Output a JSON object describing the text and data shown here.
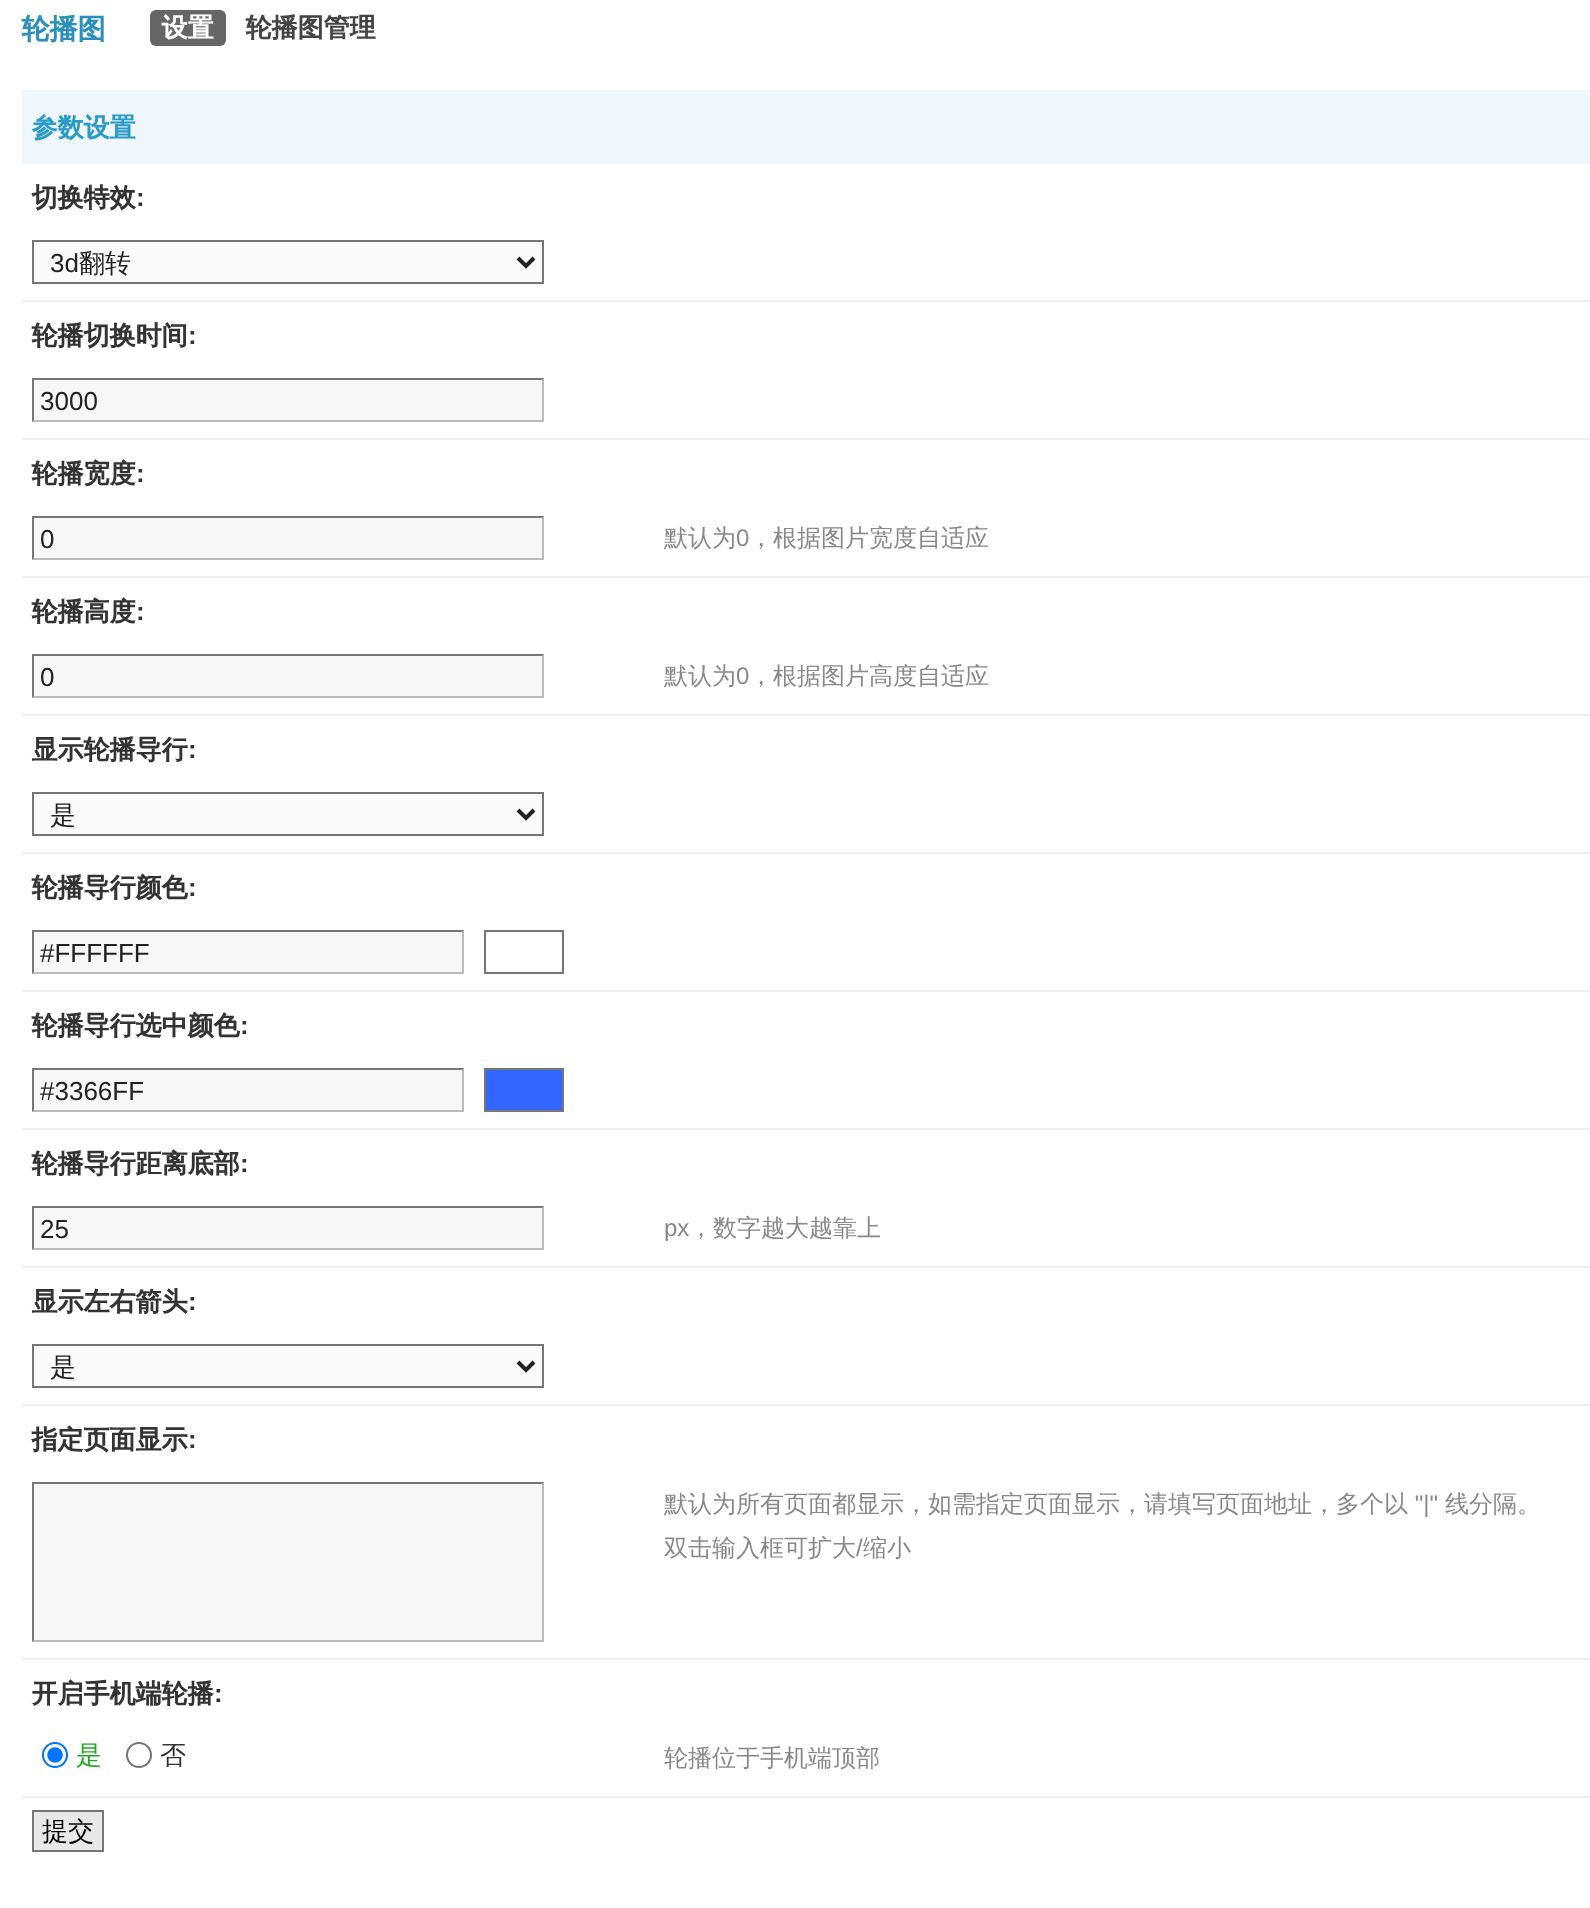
{
  "header": {
    "title": "轮播图",
    "tabs": [
      {
        "label": "设置",
        "selected": true
      },
      {
        "label": "轮播图管理",
        "selected": false
      }
    ]
  },
  "panel": {
    "title": "参数设置",
    "fields": [
      {
        "kind": "select",
        "label": "切换特效:",
        "value": "3d翻转"
      },
      {
        "kind": "text",
        "label": "轮播切换时间:",
        "value": "3000"
      },
      {
        "kind": "text",
        "label": "轮播宽度:",
        "value": "0",
        "hint": "默认为0，根据图片宽度自适应"
      },
      {
        "kind": "text",
        "label": "轮播高度:",
        "value": "0",
        "hint": "默认为0，根据图片高度自适应"
      },
      {
        "kind": "select",
        "label": "显示轮播导行:",
        "value": "是"
      },
      {
        "kind": "color",
        "label": "轮播导行颜色:",
        "value": "#FFFFFF",
        "color": "#ffffff"
      },
      {
        "kind": "color",
        "label": "轮播导行选中颜色:",
        "value": "#3366FF",
        "color": "#3366ff"
      },
      {
        "kind": "text",
        "label": "轮播导行距离底部:",
        "value": "25",
        "hint": "px，数字越大越靠上"
      },
      {
        "kind": "select",
        "label": "显示左右箭头:",
        "value": "是"
      },
      {
        "kind": "textarea",
        "label": "指定页面显示:",
        "hint": "默认为所有页面都显示，如需指定页面显示，请填写页面地址，多个以 \"|\" 线分隔。双击输入框可扩大/缩小"
      },
      {
        "kind": "radio",
        "label": "开启手机端轮播:",
        "options": [
          {
            "label": "是",
            "selected": true
          },
          {
            "label": "否",
            "selected": false
          }
        ],
        "hint": "轮播位于手机端顶部"
      }
    ],
    "submit": "提交"
  }
}
